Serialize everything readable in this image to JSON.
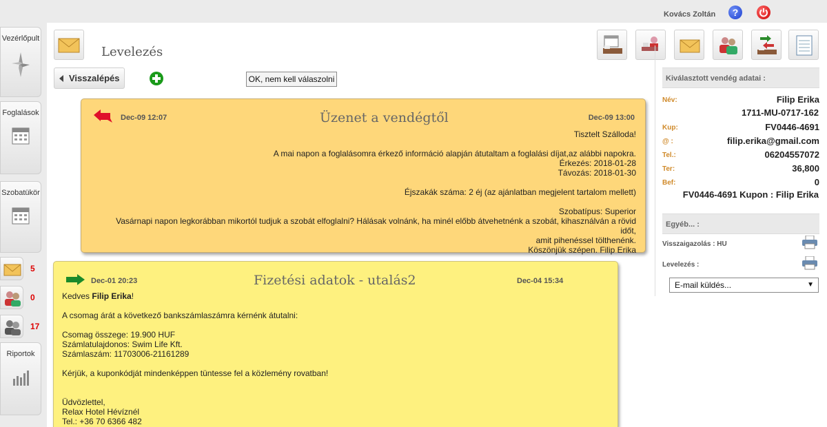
{
  "header": {
    "user_name": "Kovács Zoltán",
    "help_symbol": "?"
  },
  "sidebar": {
    "items": [
      {
        "label": "Vezérlőpult",
        "icon": "compass-icon"
      },
      {
        "label": "Foglalások",
        "icon": "calendar-icon"
      },
      {
        "label": "Szobatükör",
        "icon": "calendar-icon"
      }
    ],
    "counters": [
      {
        "icon": "envelope-icon",
        "count": "5"
      },
      {
        "icon": "guests-icon",
        "count": "0"
      },
      {
        "icon": "people-icon",
        "count": "17"
      }
    ],
    "reports_label": "Riportok"
  },
  "page": {
    "title": "Levelezés",
    "back_label": "Visszalépés",
    "ok_label": "OK, nem kell válaszolni"
  },
  "messages": [
    {
      "direction": "incoming",
      "date_left": "Dec-09 12:07",
      "subject": "Üzenet a vendégtől",
      "date_right": "Dec-09 13:00",
      "lines": [
        "Tisztelt Szálloda!",
        "",
        "A mai napon a foglalásomra érkező információ alapján átutaltam a foglalási díjat,az alábbi napokra.",
        "Érkezés: 2018-01-28",
        "Távozás: 2018-01-30",
        "",
        "Éjszakák száma: 2 éj (az ajánlatban megjelent tartalom mellett)",
        "",
        "Szobatípus: Superior",
        "Vasárnapi napon legkorábban mikortól tudjuk a szobát elfoglalni? Hálásak volnánk, ha minél előbb átvehetnénk a szobát, kihasználván a rövid időt,",
        "amit pihenéssel tölthenénk.",
        "Köszönjük szépen. Filip Erika"
      ]
    },
    {
      "direction": "outgoing",
      "date_left": "Dec-01 20:23",
      "subject": "Fizetési adatok - utalás2",
      "date_right": "Dec-04 15:34",
      "greeting_prefix": "Kedves ",
      "greeting_name": "Filip Erika",
      "greeting_suffix": "!",
      "lines": [
        "",
        "A csomag árát a következő bankszámlaszámra kérnénk átutalni:",
        "",
        "Csomag összege: 19.900 HUF",
        "Számlatulajdonos: Swim Life Kft.",
        "Számlaszám: 11703006-21161289",
        "",
        "Kérjük, a kuponkódját mindenképpen tüntesse fel a közlemény rovatban!",
        "",
        "",
        "Üdvözlettel,",
        "Relax Hotel Hévíznél",
        "Tel.: +36 70 6366 482"
      ]
    }
  ],
  "guest_panel": {
    "title": "Kiválasztott vendég adatai :",
    "name_label": "Név:",
    "name_value": "Filip Erika",
    "id_value": "1711-MU-0717-162",
    "coupon_label": "Kup:",
    "coupon_value": "FV0446-4691",
    "email_label": "@ :",
    "email_value": "filip.erika@gmail.com",
    "phone_label": "Tel.:",
    "phone_value": "06204557072",
    "ter_label": "Ter:",
    "ter_value": "36,800",
    "bef_label": "Bef:",
    "bef_value": "0",
    "summary": "FV0446-4691 Kupon : Filip Erika",
    "other_title": "Egyéb... :",
    "confirm_label": "Visszaigazolás : HU",
    "mail_label": "Levelezés :",
    "email_send_option": "E-mail küldés..."
  },
  "colors": {
    "incoming_bg": "#fed77a",
    "outgoing_bg": "#fef17f",
    "label_orange": "#d08a2a",
    "counter_red": "#dd0000"
  }
}
